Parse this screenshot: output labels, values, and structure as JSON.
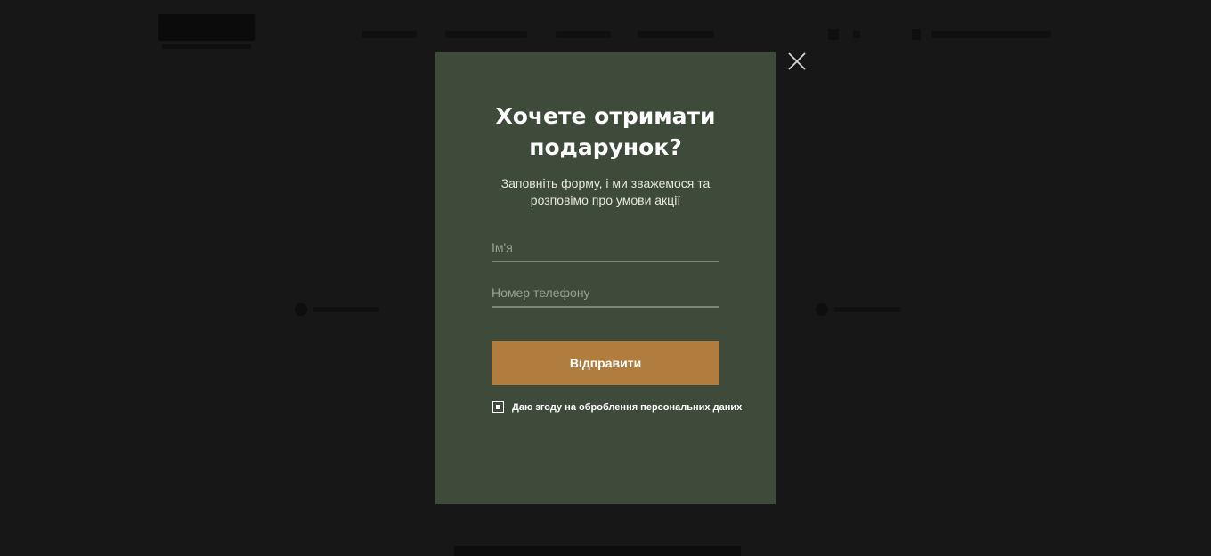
{
  "modal": {
    "title": "Хочете отримати подарунок?",
    "subtitle": "Заповніть форму, і ми зважемося та розповімо про умови акції",
    "name_field": {
      "placeholder": "Ім'я",
      "value": ""
    },
    "phone_field": {
      "placeholder": "Номер телефону",
      "value": ""
    },
    "submit_label": "Відправити",
    "consent": {
      "label": "Даю згоду на оброблення персональних даних",
      "checked": true
    },
    "close_icon": "close-icon"
  },
  "colors": {
    "overlay": "#171717",
    "modal_bg": "#3e4a3a",
    "button_bg": "#b07d3f",
    "field_underline": "#7d8779",
    "text": "#ffffff"
  }
}
